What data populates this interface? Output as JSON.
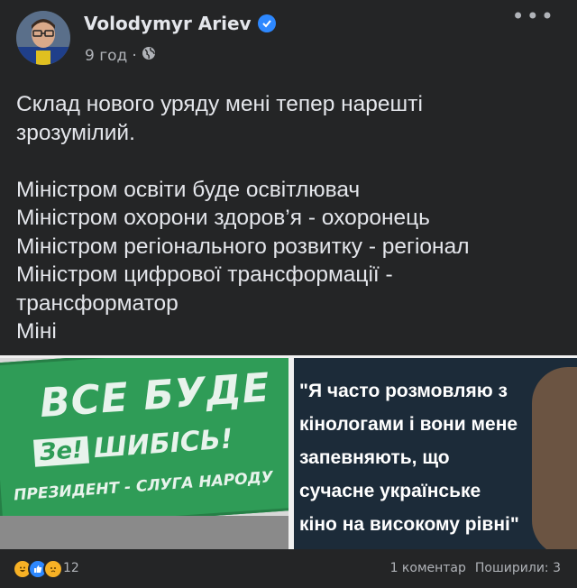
{
  "post": {
    "author": "Volodymyr Ariev",
    "time": "9 год",
    "separator": "·",
    "lines": [
      "Склад нового уряду мені тепер нарешті",
      "зрозумілий.",
      "",
      "Міністром освіти буде освітлювач",
      "Міністром охорони здоров’я - охоронець",
      "Міністром регіонального розвитку - регіонал",
      "Міністром цифрової трансформації -",
      "трансформатор",
      "Міні"
    ]
  },
  "images": {
    "billboard": {
      "line1": "ВСЕ БУДЕ",
      "ze": "Зе!",
      "line2": "ШИБІСЬ!",
      "line3": "ПРЕЗИДЕНТ - СЛУГА НАРОДУ"
    },
    "quote": {
      "lines": [
        "\"Я часто розмовляю з",
        "кінологами і вони мене",
        "запевняють, що",
        "сучасне українське",
        "кіно на високому рівні\""
      ]
    }
  },
  "footer": {
    "reaction_count": "12",
    "comments": "1 коментар",
    "shares": "Поширили: 3"
  },
  "colors": {
    "background": "#242526",
    "text": "#e4e6eb",
    "secondary": "#b0b3b8",
    "verified": "#2d88ff",
    "billboard_green": "#2f9c57"
  },
  "icons": [
    "verified-badge-icon",
    "globe-icon",
    "more-options-icon",
    "haha-reaction-icon",
    "like-reaction-icon",
    "sad-reaction-icon"
  ]
}
